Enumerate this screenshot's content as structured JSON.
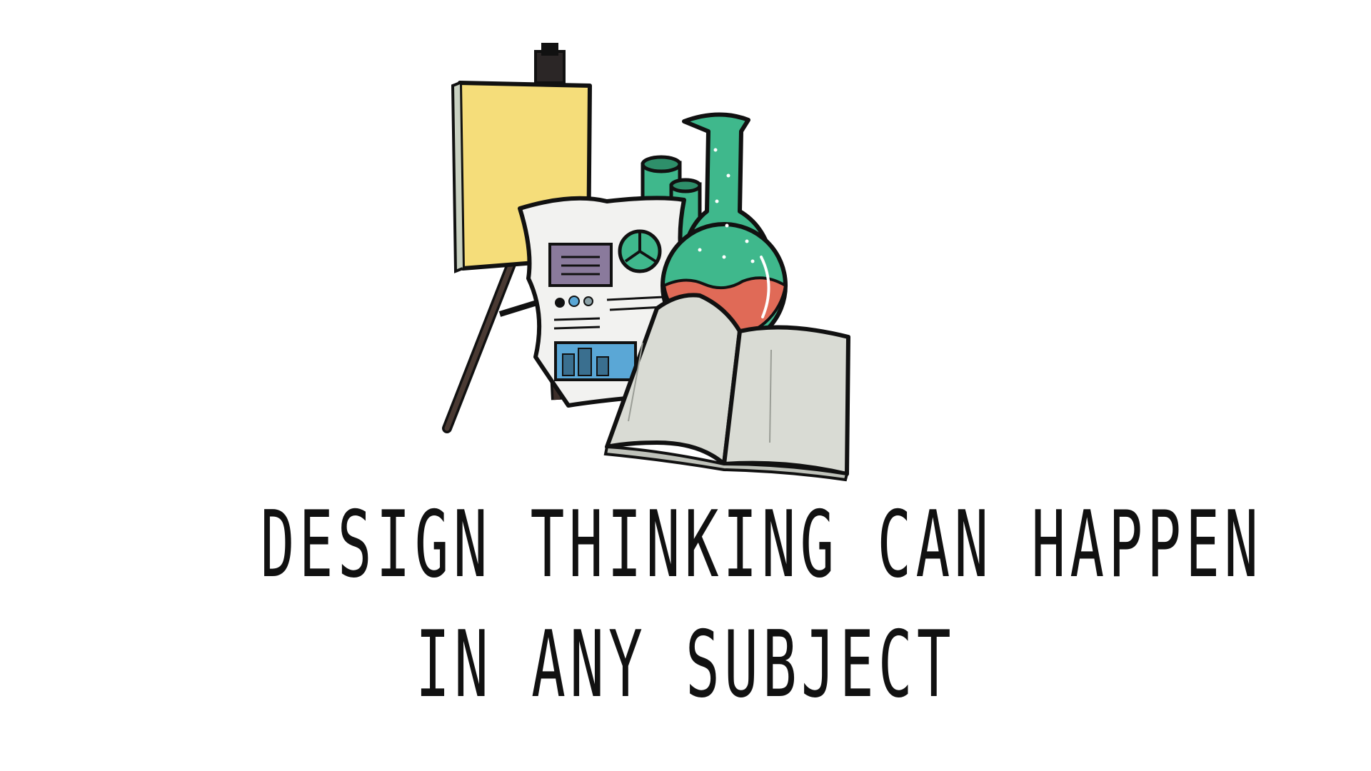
{
  "caption": {
    "line1": "DESIGN THINKING CAN HAPPEN",
    "line2": "IN ANY SUBJECT"
  },
  "icons": {
    "easel": "easel-icon",
    "canvas": "canvas-icon",
    "poster": "poster-icon",
    "pie_chart": "pie-chart-icon",
    "rolled_papers": "rolled-paper-icon",
    "flask": "round-bottom-flask-icon",
    "book": "open-book-icon"
  },
  "colors": {
    "canvas": "#f5dd7a",
    "flask_glass": "#3fb88c",
    "flask_liquid": "#e06a57",
    "poster_paper": "#f2f2f0",
    "poster_block": "#8a7a9c",
    "poster_photo": "#5aa7d6",
    "book_pages": "#d9dbd4",
    "ink": "#111111",
    "easel_wood": "#3d2f2a"
  }
}
